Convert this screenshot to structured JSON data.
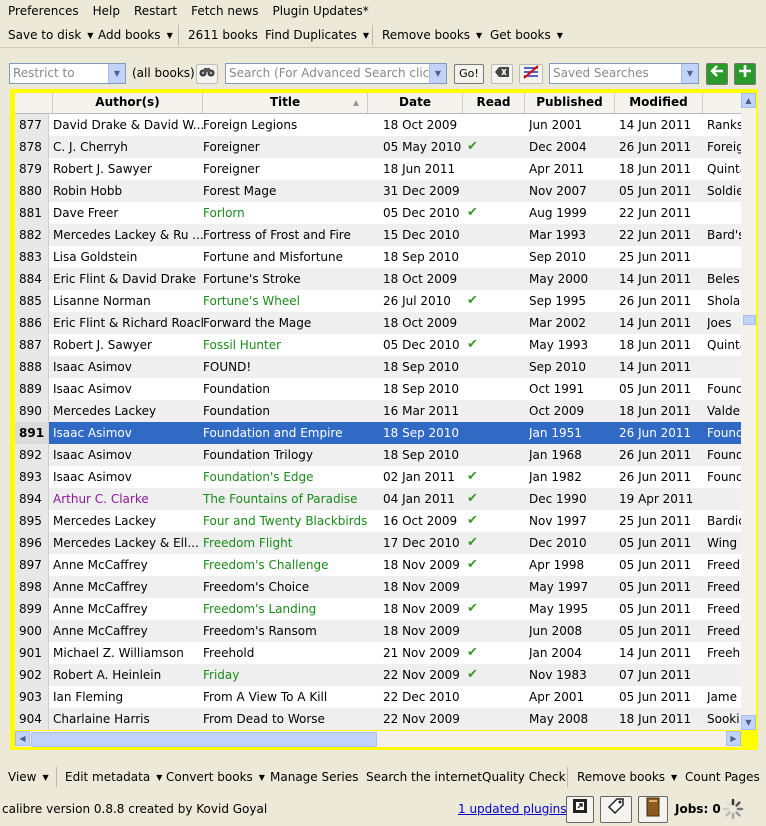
{
  "menu": [
    "Preferences",
    "Help",
    "Restart",
    "Fetch news",
    "Plugin Updates*"
  ],
  "toolbar": {
    "save_to_disk": "Save to disk",
    "add_books": "Add books",
    "book_count": "2611 books",
    "find_duplicates": "Find Duplicates",
    "remove_books": "Remove books",
    "get_books": "Get books"
  },
  "search": {
    "restrict_placeholder": "Restrict to",
    "all_books": "(all books)",
    "search_placeholder": "Search (For Advanced Search clic...",
    "go": "Go!",
    "saved_searches_placeholder": "Saved Searches"
  },
  "columns": {
    "author": "Author(s)",
    "title": "Title",
    "date": "Date",
    "read": "Read",
    "published": "Published",
    "modified": "Modified"
  },
  "rows": [
    {
      "n": "877",
      "author": "David Drake & David W...",
      "title": "Foreign Legions",
      "date": "18 Oct 2009",
      "read": "",
      "pub": "Jun 2001",
      "mod": "14 Jun 2011",
      "series": "Ranks",
      "tc": "",
      "ac": ""
    },
    {
      "n": "878",
      "author": "C. J. Cherryh",
      "title": "Foreigner",
      "date": "05 May 2010",
      "read": "✔",
      "pub": "Dec 2004",
      "mod": "26 Jun 2011",
      "series": "Foreig",
      "tc": "",
      "ac": ""
    },
    {
      "n": "879",
      "author": "Robert J. Sawyer",
      "title": "Foreigner",
      "date": "18 Jun 2011",
      "read": "",
      "pub": "Apr 2011",
      "mod": "18 Jun 2011",
      "series": "Quinta",
      "tc": "",
      "ac": ""
    },
    {
      "n": "880",
      "author": "Robin Hobb",
      "title": "Forest Mage",
      "date": "31 Dec 2009",
      "read": "",
      "pub": "Nov 2007",
      "mod": "05 Jun 2011",
      "series": "Soldie",
      "tc": "",
      "ac": ""
    },
    {
      "n": "881",
      "author": "Dave Freer",
      "title": "Forlorn",
      "date": "05 Dec 2010",
      "read": "✔",
      "pub": "Aug 1999",
      "mod": "22 Jun 2011",
      "series": "",
      "tc": "green",
      "ac": ""
    },
    {
      "n": "882",
      "author": "Mercedes Lackey & Ru ...",
      "title": "Fortress of Frost and Fire",
      "date": "15 Dec 2010",
      "read": "",
      "pub": "Mar 1993",
      "mod": "22 Jun 2011",
      "series": "Bard's",
      "tc": "",
      "ac": ""
    },
    {
      "n": "883",
      "author": "Lisa Goldstein",
      "title": "Fortune and Misfortune",
      "date": "18 Sep 2010",
      "read": "",
      "pub": "Sep 2010",
      "mod": "25 Jun 2011",
      "series": "",
      "tc": "",
      "ac": ""
    },
    {
      "n": "884",
      "author": "Eric Flint & David Drake",
      "title": "Fortune's Stroke",
      "date": "18 Oct 2009",
      "read": "",
      "pub": "May 2000",
      "mod": "14 Jun 2011",
      "series": "Beles",
      "tc": "",
      "ac": ""
    },
    {
      "n": "885",
      "author": "Lisanne Norman",
      "title": "Fortune's Wheel",
      "date": "26 Jul 2010",
      "read": "✔",
      "pub": "Sep 1995",
      "mod": "26 Jun 2011",
      "series": "Shola",
      "tc": "green",
      "ac": ""
    },
    {
      "n": "886",
      "author": "Eric Flint & Richard Roach",
      "title": "Forward the Mage",
      "date": "18 Oct 2009",
      "read": "",
      "pub": "Mar 2002",
      "mod": "14 Jun 2011",
      "series": "Joes",
      "tc": "",
      "ac": ""
    },
    {
      "n": "887",
      "author": "Robert J. Sawyer",
      "title": "Fossil Hunter",
      "date": "05 Dec 2010",
      "read": "✔",
      "pub": "May 1993",
      "mod": "18 Jun 2011",
      "series": "Quinta",
      "tc": "green",
      "ac": ""
    },
    {
      "n": "888",
      "author": "Isaac Asimov",
      "title": "FOUND!",
      "date": "18 Sep 2010",
      "read": "",
      "pub": "Sep 2010",
      "mod": "14 Jun 2011",
      "series": "",
      "tc": "",
      "ac": ""
    },
    {
      "n": "889",
      "author": "Isaac Asimov",
      "title": "Foundation",
      "date": "18 Sep 2010",
      "read": "",
      "pub": "Oct 1991",
      "mod": "05 Jun 2011",
      "series": "Found",
      "tc": "",
      "ac": ""
    },
    {
      "n": "890",
      "author": "Mercedes Lackey",
      "title": "Foundation",
      "date": "16 Mar 2011",
      "read": "",
      "pub": "Oct 2009",
      "mod": "18 Jun 2011",
      "series": "Valde",
      "tc": "",
      "ac": ""
    },
    {
      "n": "891",
      "author": "Isaac Asimov",
      "title": "Foundation and Empire",
      "date": "18 Sep 2010",
      "read": "",
      "pub": "Jan 1951",
      "mod": "26 Jun 2011",
      "series": "Found",
      "tc": "",
      "ac": "",
      "sel": true
    },
    {
      "n": "892",
      "author": "Isaac Asimov",
      "title": "Foundation Trilogy",
      "date": "18 Sep 2010",
      "read": "",
      "pub": "Jan 1968",
      "mod": "26 Jun 2011",
      "series": "Found",
      "tc": "",
      "ac": ""
    },
    {
      "n": "893",
      "author": "Isaac Asimov",
      "title": "Foundation's Edge",
      "date": "02 Jan 2011",
      "read": "✔",
      "pub": "Jan 1982",
      "mod": "26 Jun 2011",
      "series": "Found",
      "tc": "green",
      "ac": ""
    },
    {
      "n": "894",
      "author": "Arthur C. Clarke",
      "title": "The Fountains of Paradise",
      "date": "04 Jan 2011",
      "read": "✔",
      "pub": "Dec 1990",
      "mod": "19 Apr 2011",
      "series": "",
      "tc": "green",
      "ac": "purple"
    },
    {
      "n": "895",
      "author": "Mercedes Lackey",
      "title": "Four and Twenty Blackbirds",
      "date": "16 Oct 2009",
      "read": "✔",
      "pub": "Nov 1997",
      "mod": "25 Jun 2011",
      "series": "Bardic",
      "tc": "green",
      "ac": ""
    },
    {
      "n": "896",
      "author": "Mercedes Lackey & Ell...",
      "title": "Freedom Flight",
      "date": "17 Dec 2010",
      "read": "✔",
      "pub": "Dec 2010",
      "mod": "05 Jun 2011",
      "series": "Wing",
      "tc": "green",
      "ac": ""
    },
    {
      "n": "897",
      "author": "Anne McCaffrey",
      "title": "Freedom's Challenge",
      "date": "18 Nov 2009",
      "read": "✔",
      "pub": "Apr 1998",
      "mod": "05 Jun 2011",
      "series": "Freed",
      "tc": "green",
      "ac": ""
    },
    {
      "n": "898",
      "author": "Anne McCaffrey",
      "title": "Freedom's Choice",
      "date": "18 Nov 2009",
      "read": "",
      "pub": "May 1997",
      "mod": "05 Jun 2011",
      "series": "Freed",
      "tc": "",
      "ac": ""
    },
    {
      "n": "899",
      "author": "Anne McCaffrey",
      "title": "Freedom's Landing",
      "date": "18 Nov 2009",
      "read": "✔",
      "pub": "May 1995",
      "mod": "05 Jun 2011",
      "series": "Freed",
      "tc": "green",
      "ac": ""
    },
    {
      "n": "900",
      "author": "Anne McCaffrey",
      "title": "Freedom's Ransom",
      "date": "18 Nov 2009",
      "read": "",
      "pub": "Jun 2008",
      "mod": "05 Jun 2011",
      "series": "Freed",
      "tc": "",
      "ac": ""
    },
    {
      "n": "901",
      "author": "Michael Z. Williamson",
      "title": "Freehold",
      "date": "21 Nov 2009",
      "read": "✔",
      "pub": "Jan 2004",
      "mod": "14 Jun 2011",
      "series": "Freeh",
      "tc": "",
      "ac": ""
    },
    {
      "n": "902",
      "author": "Robert A. Heinlein",
      "title": "Friday",
      "date": "22 Nov 2009",
      "read": "✔",
      "pub": "Nov 1983",
      "mod": "07 Jun 2011",
      "series": "",
      "tc": "green",
      "ac": ""
    },
    {
      "n": "903",
      "author": "Ian Fleming",
      "title": "From A View To A Kill",
      "date": "22 Dec 2010",
      "read": "",
      "pub": "Apr 2001",
      "mod": "05 Jun 2011",
      "series": "Jame",
      "tc": "",
      "ac": ""
    },
    {
      "n": "904",
      "author": "Charlaine Harris",
      "title": "From Dead to Worse",
      "date": "22 Nov 2009",
      "read": "",
      "pub": "May 2008",
      "mod": "18 Jun 2011",
      "series": "Sooki",
      "tc": "",
      "ac": ""
    }
  ],
  "bottom_toolbar": {
    "view": "View",
    "edit_metadata": "Edit metadata",
    "convert_books": "Convert books",
    "manage_series": "Manage Series",
    "search_internet": "Search the internet",
    "quality_check": "Quality Check",
    "remove_books": "Remove books",
    "count_pages": "Count Pages"
  },
  "status": {
    "version": "calibre version 0.8.8 created by Kovid Goyal",
    "updated_plugins": "1 updated plugins",
    "jobs": "Jobs: 0"
  },
  "colors": {
    "selection": "#316ac5",
    "frame": "#ffff00",
    "read_check": "#3c9a2c",
    "title_green": "#1a8a1a",
    "author_purple": "#8b1a9a",
    "link": "#0000cc"
  }
}
